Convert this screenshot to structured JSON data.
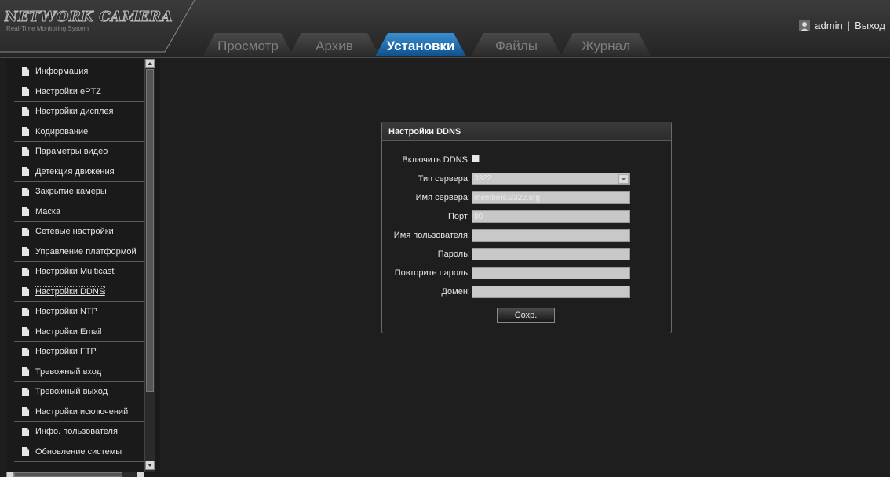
{
  "app": {
    "logo_title": "NETWORK CAMERA",
    "logo_subtitle": "Real-Time Monitoring System"
  },
  "tabs": [
    {
      "label": "Просмотр",
      "active": false
    },
    {
      "label": "Архив",
      "active": false
    },
    {
      "label": "Установки",
      "active": true
    },
    {
      "label": "Файлы",
      "active": false
    },
    {
      "label": "Журнал",
      "active": false
    }
  ],
  "user": {
    "icon": "user-icon",
    "name": "admin",
    "separator": "|",
    "logout_label": "Выход"
  },
  "sidebar": {
    "item_icon": "document-icon",
    "items": [
      {
        "label": "Информация"
      },
      {
        "label": "Настройки ePTZ"
      },
      {
        "label": "Настройки дисплея"
      },
      {
        "label": "Кодирование"
      },
      {
        "label": "Параметры видео"
      },
      {
        "label": "Детекция движения"
      },
      {
        "label": "Закрытие камеры"
      },
      {
        "label": "Маска"
      },
      {
        "label": "Сетевые настройки"
      },
      {
        "label": "Управление платформой"
      },
      {
        "label": "Настройки Multicast"
      },
      {
        "label": "Настройки DDNS",
        "active": true
      },
      {
        "label": "Настройки NTP"
      },
      {
        "label": "Настройки Email"
      },
      {
        "label": "Настройки FTP"
      },
      {
        "label": "Тревожный вход"
      },
      {
        "label": "Тревожный выход"
      },
      {
        "label": "Настройки исключений"
      },
      {
        "label": "Инфо. пользователя"
      },
      {
        "label": "Обновление системы"
      }
    ]
  },
  "ddns": {
    "title": "Настройки DDNS",
    "enable_label": "Включить DDNS:",
    "enable_checked": false,
    "server_type_label": "Тип сервера:",
    "server_type_value": "3322",
    "server_name_label": "Имя сервера:",
    "server_name_value": "members.3322.org",
    "port_label": "Порт:",
    "port_value": "80",
    "username_label": "Имя пользователя:",
    "username_value": "",
    "password_label": "Пароль:",
    "password_value": "",
    "confirm_password_label": "Повторите пароль:",
    "confirm_password_value": "",
    "domain_label": "Домен:",
    "domain_value": "",
    "save_label": "Сохр."
  },
  "colors": {
    "background": "#1e1e1e",
    "active_tab": "#1d6fb0",
    "field_bg": "#c8c8c8"
  }
}
